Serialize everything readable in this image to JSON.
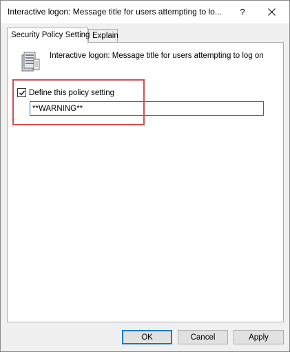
{
  "window": {
    "title": "Interactive logon: Message title for users attempting to lo...",
    "help_label": "?"
  },
  "tabs": [
    {
      "label": "Security Policy Setting",
      "active": true
    },
    {
      "label": "Explain",
      "active": false
    }
  ],
  "panel": {
    "policy_title": "Interactive logon: Message title for users attempting to log on",
    "define_checkbox": {
      "label": "Define this policy setting",
      "checked": true
    },
    "input_value": "**WARNING**"
  },
  "buttons": {
    "ok": "OK",
    "cancel": "Cancel",
    "apply": "Apply"
  },
  "colors": {
    "highlight": "#e0474c",
    "focus_accent": "#0078d7"
  },
  "icons": {
    "policy": "server-icon",
    "close": "close-icon",
    "check": "checkmark-icon"
  }
}
